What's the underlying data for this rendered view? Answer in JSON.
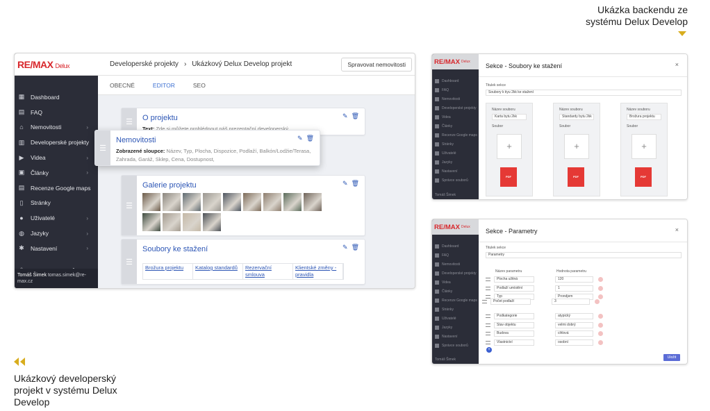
{
  "captions": {
    "top_line1": "Ukázka backendu ze",
    "top_line2": "systému Delux Develop",
    "bottom": "Ukázkový developerský projekt v systému Delux Develop"
  },
  "colors": {
    "accent_gold": "#d8ad1e",
    "sidebar": "#2b2d38",
    "link_blue": "#2d56b5",
    "brand_red": "#d8262b"
  },
  "main": {
    "logo_text": "RE/MAX",
    "logo_sub": "Delux",
    "breadcrumb": [
      "Developerské projekty",
      "›",
      "Ukázkový Delux Develop projekt"
    ],
    "manage_button": "Spravovat nemovitosti",
    "tabs": [
      {
        "label": "OBECNÉ",
        "active": false
      },
      {
        "label": "EDITOR",
        "active": true
      },
      {
        "label": "SEO",
        "active": false
      }
    ],
    "sidebar": [
      {
        "label": "Dashboard",
        "icon": "dashboard-icon",
        "chevron": false
      },
      {
        "label": "FAQ",
        "icon": "chat-icon",
        "chevron": false
      },
      {
        "label": "Nemovitosti",
        "icon": "home-icon",
        "chevron": true
      },
      {
        "label": "Developerské projekty",
        "icon": "building-icon",
        "chevron": false
      },
      {
        "label": "Videa",
        "icon": "video-icon",
        "chevron": true
      },
      {
        "label": "Články",
        "icon": "article-icon",
        "chevron": true
      },
      {
        "label": "Recenze Google maps",
        "icon": "review-icon",
        "chevron": false
      },
      {
        "label": "Stránky",
        "icon": "page-icon",
        "chevron": false
      },
      {
        "label": "Uživatelé",
        "icon": "users-icon",
        "chevron": true
      },
      {
        "label": "Jazyky",
        "icon": "globe-icon",
        "chevron": true
      },
      {
        "label": "Nastavení",
        "icon": "gear-icon",
        "chevron": true
      },
      {
        "label": "Správce souborů",
        "icon": "upload-icon",
        "chevron": false
      }
    ],
    "user": {
      "name": "Tomáš Šimek",
      "email": "tomas.simek@re-max.cz"
    },
    "cards": {
      "project": {
        "title": "O projektu",
        "text_label": "Text:",
        "text": "Zde si můžete prohlédnout náš prezentační developerský"
      },
      "realty": {
        "title": "Nemovitosti",
        "cols_label": "Zobrazené sloupce:",
        "cols": "Název, Typ, Plocha, Dispozice, Podlaží, Balkón/Lodžie/Terasa, Zahrada, Garáž, Sklep, Cena, Dostupnost,"
      },
      "gallery": {
        "title": "Galerie projektu"
      },
      "downloads": {
        "title": "Soubory ke stažení",
        "files": [
          "Brožura projektu",
          "Katalog standardů",
          "Rezervační smlouva",
          "Klientské změny - pravidla"
        ]
      }
    },
    "gallery_photos": [
      "#6b5a48",
      "#8a857d",
      "#5f6a70",
      "#9a9690",
      "#4d5560",
      "#7c6a58",
      "#8d7d6d",
      "#5a6b5a",
      "#6e6258",
      "#3d4a3e",
      "#a39a8e",
      "#c4b8a6",
      "#4a4f55"
    ]
  },
  "files_modal": {
    "logo_text": "RE/MAX",
    "logo_sub": "Delux",
    "title": "Sekce - Soubory ke stažení",
    "close": "×",
    "section_title_label": "Titulek sekce",
    "section_title_value": "Soubory k tiyu 2kk ke stažení",
    "sidebar": [
      "Dashboard",
      "FAQ",
      "Nemovitosti",
      "Developerské projekty",
      "Videa",
      "Články",
      "Recenze Google maps",
      "Stránky",
      "Uživatelé",
      "Jazyky",
      "Nastavení",
      "Správce souborů"
    ],
    "user": "Tomáš Šimek",
    "file_name_label": "Název souboru",
    "file_label": "Soubor",
    "pdf_label": "PDF",
    "files": [
      "Karta bytu 2kk",
      "Standardy bytu 2kk",
      "Brožura projektu"
    ]
  },
  "params_modal": {
    "logo_text": "RE/MAX",
    "logo_sub": "Delux",
    "title": "Sekce - Parametry",
    "close": "×",
    "section_title_label": "Titulek sekce",
    "section_title_value": "Parametry",
    "col_name": "Název parametru",
    "col_value": "Hodnota parametru",
    "sidebar": [
      "Dashboard",
      "FAQ",
      "Nemovitosti",
      "Developerské projekty",
      "Videa",
      "Články",
      "Recenze Google maps",
      "Stránky",
      "Uživatelé",
      "Jazyky",
      "Nastavení",
      "Správce souborů"
    ],
    "user": "Tomáš Šimek",
    "rows": [
      {
        "name": "Plocha užitná",
        "value": "120"
      },
      {
        "name": "Podlaží umístění",
        "value": "1"
      },
      {
        "name": "Typ",
        "value": "Prondjem"
      },
      {
        "name": "Počet podlaží",
        "value": "3"
      },
      {
        "name": "Podkategorie",
        "value": "atypický"
      },
      {
        "name": "Stav objektu",
        "value": "velmi dobrý"
      },
      {
        "name": "Budova",
        "value": "cihlová"
      },
      {
        "name": "Vlastnictví",
        "value": "osobní"
      }
    ],
    "add_label": "+",
    "save_label": "Uložit"
  }
}
